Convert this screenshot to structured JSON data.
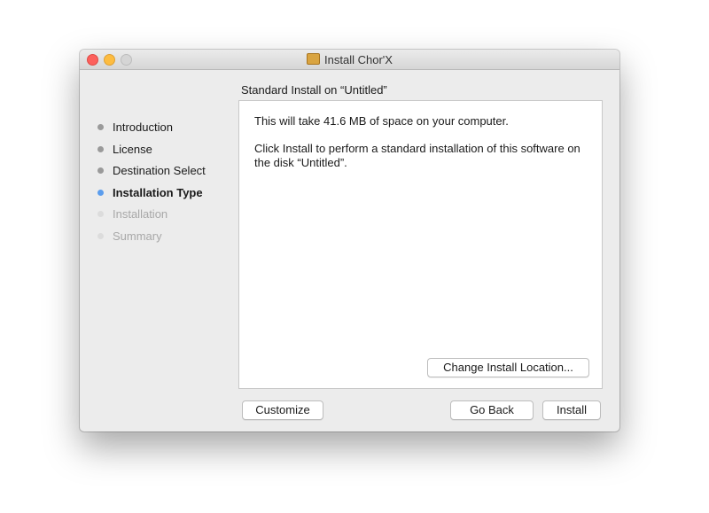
{
  "window": {
    "title": "Install Chor'X"
  },
  "sidebar": {
    "items": [
      {
        "label": "Introduction",
        "state": "done"
      },
      {
        "label": "License",
        "state": "done"
      },
      {
        "label": "Destination Select",
        "state": "done"
      },
      {
        "label": "Installation Type",
        "state": "current"
      },
      {
        "label": "Installation",
        "state": "pending"
      },
      {
        "label": "Summary",
        "state": "pending"
      }
    ]
  },
  "main": {
    "heading": "Standard Install on “Untitled”",
    "space_text": "This will take 41.6 MB of space on your computer.",
    "instruction_text": "Click Install to perform a standard installation of this software on the disk “Untitled”.",
    "change_location_label": "Change Install Location..."
  },
  "footer": {
    "customize_label": "Customize",
    "go_back_label": "Go Back",
    "install_label": "Install"
  },
  "colors": {
    "close": "#fc605c",
    "minimize": "#fdbc40",
    "zoom_disabled": "#d5d5d5",
    "current_dot": "#5b9ded",
    "done_dot": "#9a9a9a",
    "pending_dot": "#dcdcdc"
  }
}
